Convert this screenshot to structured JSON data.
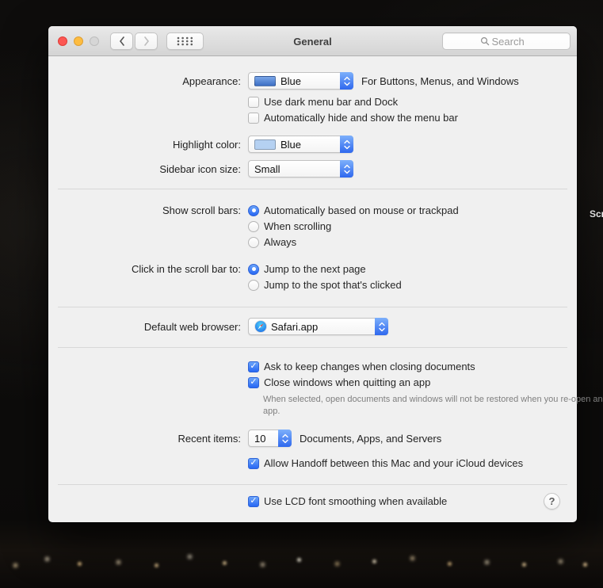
{
  "desktop": {
    "partial_label": "Scr"
  },
  "window": {
    "title": "General",
    "search_placeholder": "Search"
  },
  "appearance": {
    "label": "Appearance:",
    "value": "Blue",
    "hint": "For Buttons, Menus, and Windows",
    "dark_menu_checkbox": "Use dark menu bar and Dock",
    "dark_menu_checked": false,
    "autohide_checkbox": "Automatically hide and show the menu bar",
    "autohide_checked": false
  },
  "highlight": {
    "label": "Highlight color:",
    "value": "Blue"
  },
  "sidebar_icon_size": {
    "label": "Sidebar icon size:",
    "value": "Small"
  },
  "scroll_bars": {
    "label": "Show scroll bars:",
    "options": [
      "Automatically based on mouse or trackpad",
      "When scrolling",
      "Always"
    ],
    "selected": 0
  },
  "scroll_click": {
    "label": "Click in the scroll bar to:",
    "options": [
      "Jump to the next page",
      "Jump to the spot that's clicked"
    ],
    "selected": 0
  },
  "browser": {
    "label": "Default web browser:",
    "value": "Safari.app"
  },
  "documents": {
    "ask_checkbox": "Ask to keep changes when closing documents",
    "ask_checked": true,
    "close_windows_checkbox": "Close windows when quitting an app",
    "close_windows_checked": true,
    "note": "When selected, open documents and windows will not be restored when you re-open an app."
  },
  "recent_items": {
    "label": "Recent items:",
    "value": "10",
    "hint": "Documents, Apps, and Servers",
    "handoff_checkbox": "Allow Handoff between this Mac and your iCloud devices",
    "handoff_checked": true
  },
  "font_smoothing": {
    "checkbox": "Use LCD font smoothing when available",
    "checked": true
  },
  "help": {
    "label": "?"
  },
  "colors": {
    "accent_blue": "#2f68ee",
    "appearance_swatch_top": "#7ba7e8",
    "appearance_swatch_bottom": "#3d6fc4",
    "highlight_swatch": "#b5d1f2",
    "window_bg": "#f0f0f0",
    "titlebar_top": "#e9e9e9",
    "titlebar_bottom": "#d4d4d4"
  }
}
